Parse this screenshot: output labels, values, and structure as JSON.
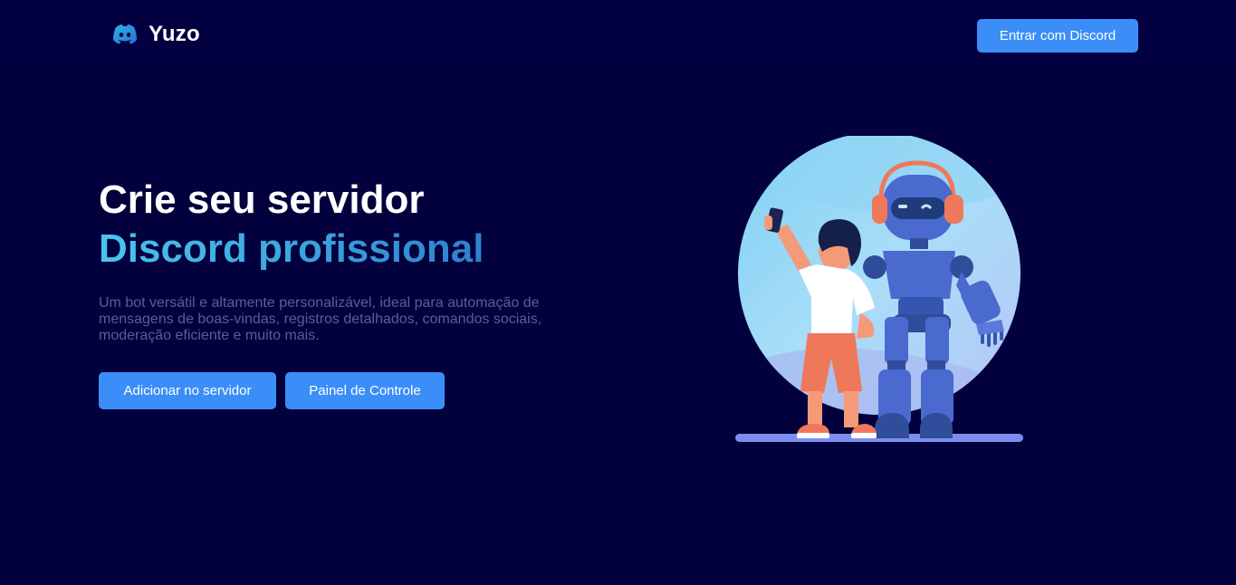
{
  "header": {
    "brand_name": "Yuzo",
    "login_button": "Entrar com Discord"
  },
  "hero": {
    "title_line1": "Crie seu servidor",
    "title_line2": "Discord profissional",
    "description": "Um bot versátil e altamente personalizável, ideal para automação de mensagens de boas-vindas, registros detalhados, comandos sociais, moderação eficiente e muito mais.",
    "primary_button": "Adicionar no servidor",
    "secondary_button": "Painel de Controle"
  },
  "icons": {
    "brand": "discord-logo-icon"
  },
  "colors": {
    "background": "#02003d",
    "accent": "#3b8ef7",
    "gradient_start": "#4cc4ee",
    "gradient_end": "#2f7fce",
    "description_text": "#5b5f92"
  }
}
